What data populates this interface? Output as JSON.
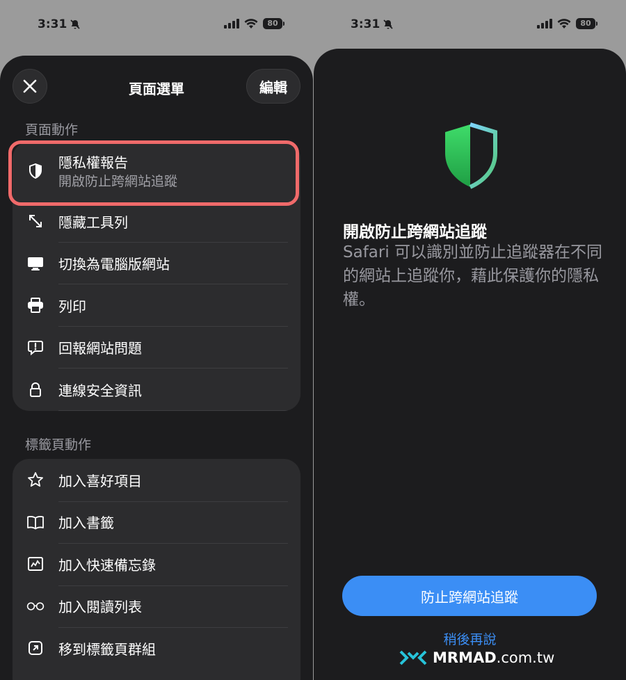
{
  "status_left": {
    "time": "3:31",
    "battery": "80"
  },
  "status_right": {
    "time": "3:31",
    "battery": "80"
  },
  "menu": {
    "title": "頁面選單",
    "edit_label": "編輯",
    "page_actions_header": "頁面動作",
    "page_actions": [
      {
        "icon": "shield-icon",
        "label": "隱私權報告",
        "subtitle": "開啟防止跨網站追蹤"
      },
      {
        "icon": "resize-arrows-icon",
        "label": "隱藏工具列"
      },
      {
        "icon": "desktop-icon",
        "label": "切換為電腦版網站"
      },
      {
        "icon": "printer-icon",
        "label": "列印"
      },
      {
        "icon": "report-bubble-icon",
        "label": "回報網站問題"
      },
      {
        "icon": "lock-icon",
        "label": "連線安全資訊"
      }
    ],
    "tab_actions_header": "標籤頁動作",
    "tab_actions": [
      {
        "icon": "star-icon",
        "label": "加入喜好項目"
      },
      {
        "icon": "book-icon",
        "label": "加入書籤"
      },
      {
        "icon": "quick-note-icon",
        "label": "加入快速備忘錄"
      },
      {
        "icon": "glasses-icon",
        "label": "加入閱讀列表"
      },
      {
        "icon": "move-to-group-icon",
        "label": "移到標籤頁群組"
      }
    ]
  },
  "privacy_sheet": {
    "title": "開啟防止跨網站追蹤",
    "body": "Safari 可以識別並防止追蹤器在不同的網站上追蹤你，藉此保護你的隱私權。",
    "primary_button": "防止跨網站追蹤",
    "secondary_link": "稍後再說"
  },
  "watermark": {
    "brand": "MRMAD",
    "suffix": ".com.tw"
  },
  "colors": {
    "accent": "#3b8ef5",
    "highlight": "#f06a6a",
    "shield_green": "#34c759"
  }
}
